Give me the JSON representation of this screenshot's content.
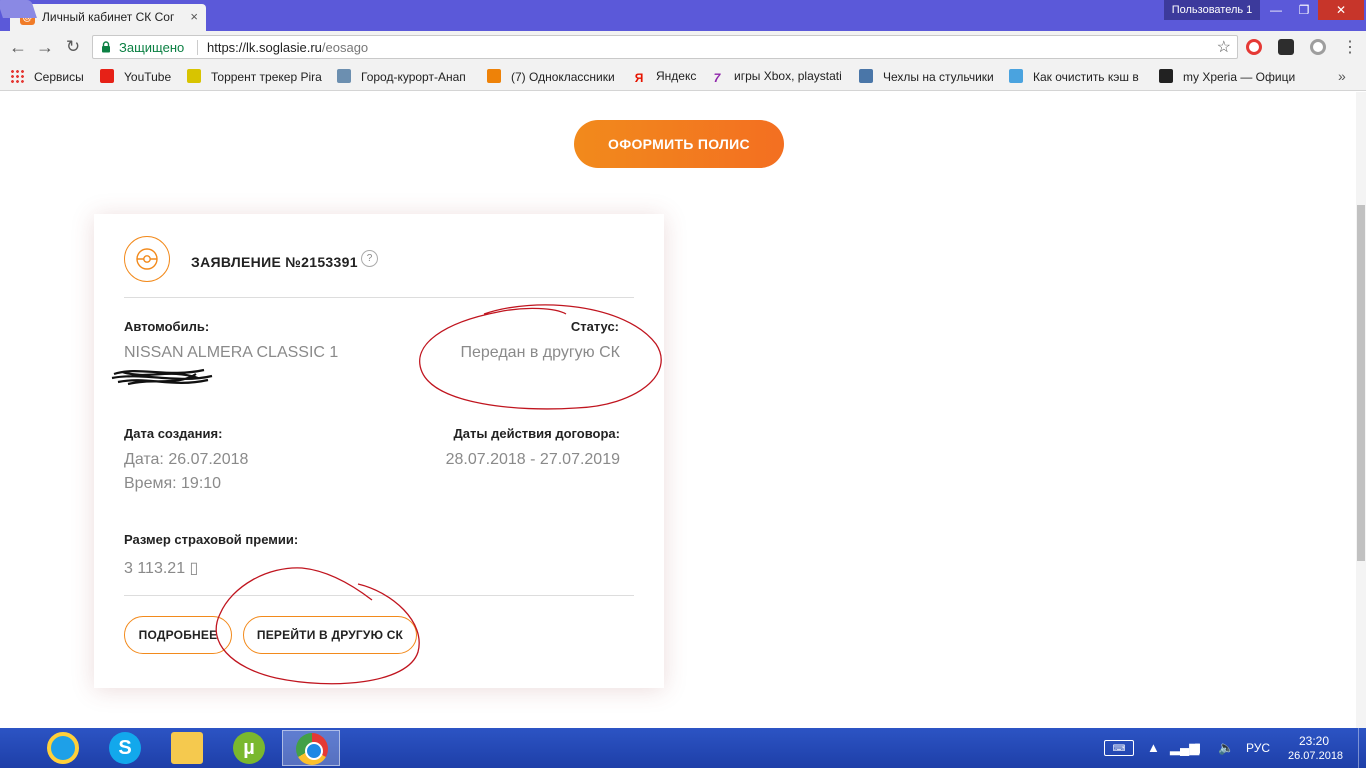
{
  "browser": {
    "tab_title": "Личный кабинет СК Сог",
    "tab_favicon": "@",
    "tab_close": "×",
    "user_badge": "Пользователь 1",
    "win_min": "—",
    "win_max": "❐",
    "win_close": "✕",
    "secure_label": "Защищено",
    "url_scheme_host": "https://lk.soglasie.ru",
    "url_path": "/eosago",
    "back": "←",
    "forward": "→",
    "reload": "↻",
    "star": "☆",
    "menu": "⋮",
    "bookmarks_more": "»"
  },
  "bookmarks": [
    {
      "label": "Сервисы",
      "icon": "apps-icon",
      "color": "#e53935"
    },
    {
      "label": "YouTube",
      "icon": "youtube-icon",
      "color": "#e62117"
    },
    {
      "label": "Торрент трекер Pira",
      "icon": "rutracker-icon",
      "color": "#d8c400"
    },
    {
      "label": "Город-курорт-Анап",
      "icon": "city-icon",
      "color": "#6c8fb0"
    },
    {
      "label": "(7) Одноклассники",
      "icon": "odnoklassniki-icon",
      "color": "#ee8208"
    },
    {
      "label": "Яндекс",
      "icon": "yandex-icon",
      "color": "#e61400"
    },
    {
      "label": "игры Xbox, playstati",
      "icon": "games-icon",
      "color": "#8e24aa"
    },
    {
      "label": "Чехлы на стульчики",
      "icon": "vk-icon",
      "color": "#4a76a8"
    },
    {
      "label": "Как очистить кэш в",
      "icon": "link-icon",
      "color": "#4aa3df"
    },
    {
      "label": "my Xperia — Офици",
      "icon": "xperia-icon",
      "color": "#222222"
    }
  ],
  "page": {
    "cta_label": "ОФОРМИТЬ ПОЛИС",
    "card": {
      "title": "ЗАЯВЛЕНИЕ №2153391",
      "help": "?",
      "car_label": "Автомобиль:",
      "car_value": "NISSAN ALMERA CLASSIC 1",
      "status_label": "Статус:",
      "status_value": "Передан в другую СК",
      "created_label": "Дата создания:",
      "created_date": "Дата: 26.07.2018",
      "created_time": "Время: 19:10",
      "period_label": "Даты действия договора:",
      "period_value": "28.07.2018 - 27.07.2019",
      "premium_label": "Размер страховой премии:",
      "premium_value": "3 113.21 ▯",
      "details_button": "ПОДРОБНЕЕ",
      "transfer_button": "ПЕРЕЙТИ В ДРУГУЮ СК"
    },
    "accent_color": "#f28a1c"
  },
  "taskbar": {
    "apps": [
      "internet-explorer",
      "skype",
      "file-explorer",
      "utorrent",
      "chrome"
    ],
    "skype_glyph": "S",
    "utorrent_glyph": "µ",
    "keyboard": "⌨",
    "tray_arrow": "▲",
    "signal": "▂▄▆",
    "battery": "▮",
    "speaker": "🔈",
    "lang": "РУС",
    "time": "23:20",
    "date": "26.07.2018"
  }
}
